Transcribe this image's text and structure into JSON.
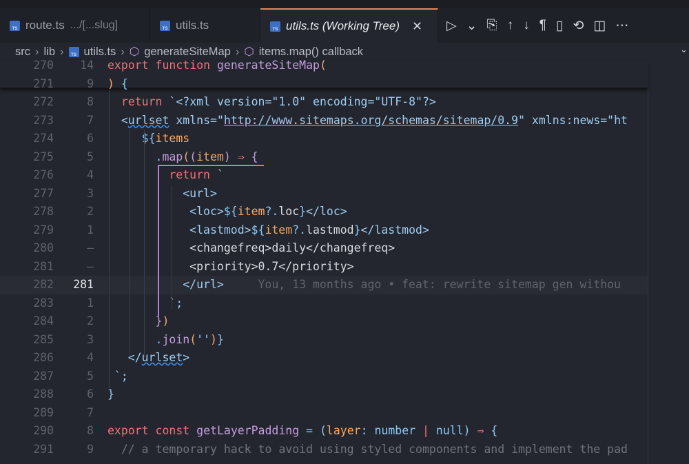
{
  "tabs": [
    {
      "label": "route.ts",
      "desc": ".../[...slug]"
    },
    {
      "label": "utils.ts",
      "desc": ""
    },
    {
      "label": "utils.ts (Working Tree)",
      "desc": ""
    }
  ],
  "ts_badge": "TS",
  "close_glyph": "✕",
  "actions": [
    {
      "name": "run",
      "glyph": "▷"
    },
    {
      "name": "run-dropdown",
      "glyph": "⌄"
    },
    {
      "name": "open-file",
      "glyph": "⎘"
    },
    {
      "name": "previous-change",
      "glyph": "↑"
    },
    {
      "name": "next-change",
      "glyph": "↓"
    },
    {
      "name": "toggle-whitespace",
      "glyph": "¶"
    },
    {
      "name": "map",
      "glyph": "▯"
    },
    {
      "name": "revert",
      "glyph": "⟲"
    },
    {
      "name": "split-editor",
      "glyph": "◫"
    },
    {
      "name": "more",
      "glyph": "⋯"
    }
  ],
  "breadcrumb": [
    "src",
    "lib",
    "utils.ts",
    "generateSiteMap",
    "items.map() callback"
  ],
  "breadcrumb_sep": "›",
  "sticky": [
    {
      "old": "270",
      "new": "14",
      "tokens": [
        [
          "export ",
          "kw"
        ],
        [
          "function ",
          "kw"
        ],
        [
          "generateSiteMap",
          "fn"
        ],
        [
          "(",
          "var"
        ]
      ]
    },
    {
      "old": "271",
      "new": "9",
      "tokens": [
        [
          ") ",
          "var"
        ],
        [
          "{",
          "pun"
        ]
      ]
    }
  ],
  "lines": [
    {
      "old": "272",
      "new": "8",
      "indent": 2,
      "tokens": [
        [
          "return ",
          "kw"
        ],
        [
          "`<?xml version=\"1.0\" encoding=\"UTF-8\"?>",
          "str"
        ]
      ]
    },
    {
      "old": "273",
      "new": "7",
      "indent": 2,
      "tokens": [
        [
          "<",
          "str"
        ],
        [
          "urlset",
          "str squig"
        ],
        [
          " xmlns=\"",
          "str"
        ],
        [
          "http://www.sitemaps.org/schemas/sitemap/0.9",
          "str url"
        ],
        [
          "\" xmlns:news=\"ht",
          "str"
        ]
      ]
    },
    {
      "old": "274",
      "new": "6",
      "indent": 5,
      "tokens": [
        [
          "${",
          "pun"
        ],
        [
          "items",
          "var"
        ]
      ]
    },
    {
      "old": "275",
      "new": "5",
      "indent": 7,
      "tokens": [
        [
          ".",
          "pun"
        ],
        [
          "map",
          "fn"
        ],
        [
          "(",
          "var"
        ],
        [
          "(",
          "fn"
        ],
        [
          "item",
          "var"
        ],
        [
          ") ",
          "fn"
        ],
        [
          "⇒ ",
          "kw"
        ],
        [
          "{",
          "fn"
        ]
      ]
    },
    {
      "old": "276",
      "new": "4",
      "indent": 9,
      "tokens": [
        [
          "return ",
          "kw"
        ],
        [
          "`",
          "str"
        ]
      ]
    },
    {
      "old": "277",
      "new": "3",
      "indent": 11,
      "tokens": [
        [
          "<url>",
          "str"
        ]
      ]
    },
    {
      "old": "278",
      "new": "2",
      "indent": 12,
      "tokens": [
        [
          "<loc>",
          "str"
        ],
        [
          "${",
          "pun"
        ],
        [
          "item",
          "var"
        ],
        [
          "?.",
          "pun"
        ],
        [
          "loc",
          "txt"
        ],
        [
          "}",
          "pun"
        ],
        [
          "</loc>",
          "str"
        ]
      ]
    },
    {
      "old": "279",
      "new": "1",
      "indent": 12,
      "tokens": [
        [
          "<lastmod>",
          "str"
        ],
        [
          "${",
          "pun"
        ],
        [
          "item",
          "var"
        ],
        [
          "?.",
          "pun"
        ],
        [
          "lastmod",
          "txt"
        ],
        [
          "}",
          "pun"
        ],
        [
          "</lastmod>",
          "str"
        ]
      ]
    },
    {
      "old": "280",
      "new": "—",
      "indent": 12,
      "deleted": true,
      "tokens": [
        [
          "<changefreq>daily</changefreq>",
          "txt"
        ]
      ]
    },
    {
      "old": "281",
      "new": "—",
      "indent": 12,
      "deleted": true,
      "tokens": [
        [
          "<priority>0.7</priority>",
          "txt"
        ]
      ]
    },
    {
      "old": "282",
      "new": "281",
      "indent": 11,
      "current": true,
      "tokens": [
        [
          "</url>",
          "str"
        ],
        [
          "     You, 13 months ago • feat: rewrite sitemap gen withou",
          "blame"
        ]
      ]
    },
    {
      "old": "283",
      "new": "1",
      "indent": 9,
      "tokens": [
        [
          "`;",
          "str"
        ]
      ]
    },
    {
      "old": "284",
      "new": "2",
      "indent": 7,
      "tokens": [
        [
          "}",
          "fn"
        ],
        [
          ")",
          "var"
        ]
      ]
    },
    {
      "old": "285",
      "new": "3",
      "indent": 7,
      "tokens": [
        [
          ".",
          "pun"
        ],
        [
          "join",
          "fn"
        ],
        [
          "(",
          "var"
        ],
        [
          "''",
          "str"
        ],
        [
          ")",
          "var"
        ],
        [
          "}",
          "pun"
        ]
      ]
    },
    {
      "old": "286",
      "new": "4",
      "indent": 3,
      "tokens": [
        [
          "</",
          "str"
        ],
        [
          "urlset",
          "str squig"
        ],
        [
          ">",
          "str"
        ]
      ]
    },
    {
      "old": "287",
      "new": "5",
      "indent": 1,
      "tokens": [
        [
          "`;",
          "str"
        ]
      ]
    },
    {
      "old": "288",
      "new": "6",
      "indent": 0,
      "tokens": [
        [
          "}",
          "pun"
        ]
      ]
    },
    {
      "old": "289",
      "new": "7",
      "indent": 0,
      "tokens": []
    },
    {
      "old": "290",
      "new": "8",
      "indent": 0,
      "tokens": [
        [
          "export ",
          "kw"
        ],
        [
          "const ",
          "kw"
        ],
        [
          "getLayerPadding",
          "fn"
        ],
        [
          " = ",
          "pun"
        ],
        [
          "(",
          "pun"
        ],
        [
          "layer",
          "var"
        ],
        [
          ": ",
          "pun"
        ],
        [
          "number",
          "pun"
        ],
        [
          " | ",
          "kw"
        ],
        [
          "null",
          "pun"
        ],
        [
          ") ",
          "pun"
        ],
        [
          "⇒ ",
          "kw"
        ],
        [
          "{",
          "pun"
        ]
      ]
    },
    {
      "old": "291",
      "new": "9",
      "indent": 2,
      "tokens": [
        [
          "// a temporary hack to avoid using styled components and implement the pad",
          "cm"
        ]
      ]
    }
  ]
}
